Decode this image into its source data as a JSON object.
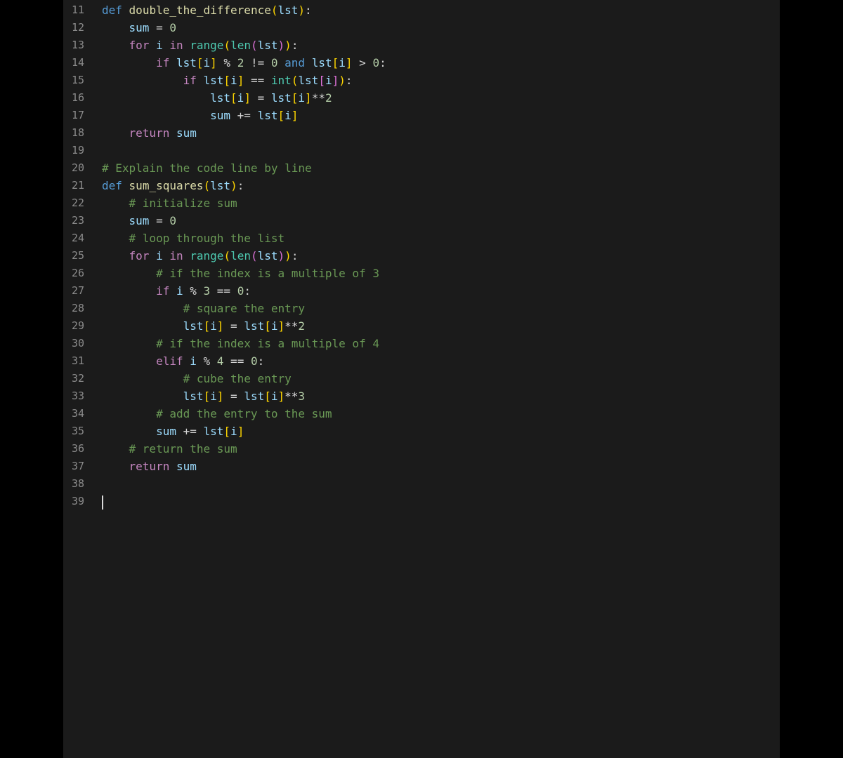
{
  "editor": {
    "background": "#1b1b1b",
    "page_background": "#000000",
    "line_number_color": "#8b8b8b",
    "cursor_color": "#d9d9d9",
    "cursor_line": "39",
    "first_line_number": "11",
    "last_line_number": "39"
  },
  "colors": {
    "pl": "#d4d4d4",
    "kw1": "#C586C0",
    "kw2": "#569CD6",
    "fn": "#DCDCAA",
    "bi": "#4EC9B0",
    "vr": "#9CDCFE",
    "nm": "#B5CEA8",
    "op": "#d4d4d4",
    "cm": "#6A9955",
    "b1": "#FFD700",
    "b2": "#DA70D6"
  },
  "lines": [
    {
      "num": "11",
      "tokens": [
        [
          "def",
          "kw2"
        ],
        [
          " ",
          "pl"
        ],
        [
          "double_the_difference",
          "fn"
        ],
        [
          "(",
          "b1"
        ],
        [
          "lst",
          "vr"
        ],
        [
          ")",
          "b1"
        ],
        [
          ":",
          "op"
        ]
      ]
    },
    {
      "num": "12",
      "tokens": [
        [
          "    ",
          "pl"
        ],
        [
          "sum",
          "vr"
        ],
        [
          " = ",
          "op"
        ],
        [
          "0",
          "nm"
        ]
      ]
    },
    {
      "num": "13",
      "tokens": [
        [
          "    ",
          "pl"
        ],
        [
          "for",
          "kw1"
        ],
        [
          " ",
          "pl"
        ],
        [
          "i",
          "vr"
        ],
        [
          " ",
          "pl"
        ],
        [
          "in",
          "kw1"
        ],
        [
          " ",
          "pl"
        ],
        [
          "range",
          "bi"
        ],
        [
          "(",
          "b1"
        ],
        [
          "len",
          "bi"
        ],
        [
          "(",
          "b2"
        ],
        [
          "lst",
          "vr"
        ],
        [
          ")",
          "b2"
        ],
        [
          ")",
          "b1"
        ],
        [
          ":",
          "op"
        ]
      ]
    },
    {
      "num": "14",
      "tokens": [
        [
          "        ",
          "pl"
        ],
        [
          "if",
          "kw1"
        ],
        [
          " ",
          "pl"
        ],
        [
          "lst",
          "vr"
        ],
        [
          "[",
          "b1"
        ],
        [
          "i",
          "vr"
        ],
        [
          "]",
          "b1"
        ],
        [
          " % ",
          "op"
        ],
        [
          "2",
          "nm"
        ],
        [
          " != ",
          "op"
        ],
        [
          "0",
          "nm"
        ],
        [
          " ",
          "pl"
        ],
        [
          "and",
          "kw2"
        ],
        [
          " ",
          "pl"
        ],
        [
          "lst",
          "vr"
        ],
        [
          "[",
          "b1"
        ],
        [
          "i",
          "vr"
        ],
        [
          "]",
          "b1"
        ],
        [
          " > ",
          "op"
        ],
        [
          "0",
          "nm"
        ],
        [
          ":",
          "op"
        ]
      ]
    },
    {
      "num": "15",
      "tokens": [
        [
          "            ",
          "pl"
        ],
        [
          "if",
          "kw1"
        ],
        [
          " ",
          "pl"
        ],
        [
          "lst",
          "vr"
        ],
        [
          "[",
          "b1"
        ],
        [
          "i",
          "vr"
        ],
        [
          "]",
          "b1"
        ],
        [
          " == ",
          "op"
        ],
        [
          "int",
          "bi"
        ],
        [
          "(",
          "b1"
        ],
        [
          "lst",
          "vr"
        ],
        [
          "[",
          "b2"
        ],
        [
          "i",
          "vr"
        ],
        [
          "]",
          "b2"
        ],
        [
          ")",
          "b1"
        ],
        [
          ":",
          "op"
        ]
      ]
    },
    {
      "num": "16",
      "tokens": [
        [
          "                ",
          "pl"
        ],
        [
          "lst",
          "vr"
        ],
        [
          "[",
          "b1"
        ],
        [
          "i",
          "vr"
        ],
        [
          "]",
          "b1"
        ],
        [
          " = ",
          "op"
        ],
        [
          "lst",
          "vr"
        ],
        [
          "[",
          "b1"
        ],
        [
          "i",
          "vr"
        ],
        [
          "]",
          "b1"
        ],
        [
          "**",
          "op"
        ],
        [
          "2",
          "nm"
        ]
      ]
    },
    {
      "num": "17",
      "tokens": [
        [
          "                ",
          "pl"
        ],
        [
          "sum",
          "vr"
        ],
        [
          " += ",
          "op"
        ],
        [
          "lst",
          "vr"
        ],
        [
          "[",
          "b1"
        ],
        [
          "i",
          "vr"
        ],
        [
          "]",
          "b1"
        ]
      ]
    },
    {
      "num": "18",
      "tokens": [
        [
          "    ",
          "pl"
        ],
        [
          "return",
          "kw1"
        ],
        [
          " ",
          "pl"
        ],
        [
          "sum",
          "vr"
        ]
      ]
    },
    {
      "num": "19",
      "tokens": []
    },
    {
      "num": "20",
      "tokens": [
        [
          "# Explain the code line by line",
          "cm"
        ]
      ]
    },
    {
      "num": "21",
      "tokens": [
        [
          "def",
          "kw2"
        ],
        [
          " ",
          "pl"
        ],
        [
          "sum_squares",
          "fn"
        ],
        [
          "(",
          "b1"
        ],
        [
          "lst",
          "vr"
        ],
        [
          ")",
          "b1"
        ],
        [
          ":",
          "op"
        ]
      ]
    },
    {
      "num": "22",
      "tokens": [
        [
          "    ",
          "pl"
        ],
        [
          "# initialize sum",
          "cm"
        ]
      ]
    },
    {
      "num": "23",
      "tokens": [
        [
          "    ",
          "pl"
        ],
        [
          "sum",
          "vr"
        ],
        [
          " = ",
          "op"
        ],
        [
          "0",
          "nm"
        ]
      ]
    },
    {
      "num": "24",
      "tokens": [
        [
          "    ",
          "pl"
        ],
        [
          "# loop through the list",
          "cm"
        ]
      ]
    },
    {
      "num": "25",
      "tokens": [
        [
          "    ",
          "pl"
        ],
        [
          "for",
          "kw1"
        ],
        [
          " ",
          "pl"
        ],
        [
          "i",
          "vr"
        ],
        [
          " ",
          "pl"
        ],
        [
          "in",
          "kw1"
        ],
        [
          " ",
          "pl"
        ],
        [
          "range",
          "bi"
        ],
        [
          "(",
          "b1"
        ],
        [
          "len",
          "bi"
        ],
        [
          "(",
          "b2"
        ],
        [
          "lst",
          "vr"
        ],
        [
          ")",
          "b2"
        ],
        [
          ")",
          "b1"
        ],
        [
          ":",
          "op"
        ]
      ]
    },
    {
      "num": "26",
      "tokens": [
        [
          "        ",
          "pl"
        ],
        [
          "# if the index is a multiple of 3",
          "cm"
        ]
      ]
    },
    {
      "num": "27",
      "tokens": [
        [
          "        ",
          "pl"
        ],
        [
          "if",
          "kw1"
        ],
        [
          " ",
          "pl"
        ],
        [
          "i",
          "vr"
        ],
        [
          " % ",
          "op"
        ],
        [
          "3",
          "nm"
        ],
        [
          " == ",
          "op"
        ],
        [
          "0",
          "nm"
        ],
        [
          ":",
          "op"
        ]
      ]
    },
    {
      "num": "28",
      "tokens": [
        [
          "            ",
          "pl"
        ],
        [
          "# square the entry",
          "cm"
        ]
      ]
    },
    {
      "num": "29",
      "tokens": [
        [
          "            ",
          "pl"
        ],
        [
          "lst",
          "vr"
        ],
        [
          "[",
          "b1"
        ],
        [
          "i",
          "vr"
        ],
        [
          "]",
          "b1"
        ],
        [
          " = ",
          "op"
        ],
        [
          "lst",
          "vr"
        ],
        [
          "[",
          "b1"
        ],
        [
          "i",
          "vr"
        ],
        [
          "]",
          "b1"
        ],
        [
          "**",
          "op"
        ],
        [
          "2",
          "nm"
        ]
      ]
    },
    {
      "num": "30",
      "tokens": [
        [
          "        ",
          "pl"
        ],
        [
          "# if the index is a multiple of 4",
          "cm"
        ]
      ]
    },
    {
      "num": "31",
      "tokens": [
        [
          "        ",
          "pl"
        ],
        [
          "elif",
          "kw1"
        ],
        [
          " ",
          "pl"
        ],
        [
          "i",
          "vr"
        ],
        [
          " % ",
          "op"
        ],
        [
          "4",
          "nm"
        ],
        [
          " == ",
          "op"
        ],
        [
          "0",
          "nm"
        ],
        [
          ":",
          "op"
        ]
      ]
    },
    {
      "num": "32",
      "tokens": [
        [
          "            ",
          "pl"
        ],
        [
          "# cube the entry",
          "cm"
        ]
      ]
    },
    {
      "num": "33",
      "tokens": [
        [
          "            ",
          "pl"
        ],
        [
          "lst",
          "vr"
        ],
        [
          "[",
          "b1"
        ],
        [
          "i",
          "vr"
        ],
        [
          "]",
          "b1"
        ],
        [
          " = ",
          "op"
        ],
        [
          "lst",
          "vr"
        ],
        [
          "[",
          "b1"
        ],
        [
          "i",
          "vr"
        ],
        [
          "]",
          "b1"
        ],
        [
          "**",
          "op"
        ],
        [
          "3",
          "nm"
        ]
      ]
    },
    {
      "num": "34",
      "tokens": [
        [
          "        ",
          "pl"
        ],
        [
          "# add the entry to the sum",
          "cm"
        ]
      ]
    },
    {
      "num": "35",
      "tokens": [
        [
          "        ",
          "pl"
        ],
        [
          "sum",
          "vr"
        ],
        [
          " += ",
          "op"
        ],
        [
          "lst",
          "vr"
        ],
        [
          "[",
          "b1"
        ],
        [
          "i",
          "vr"
        ],
        [
          "]",
          "b1"
        ]
      ]
    },
    {
      "num": "36",
      "tokens": [
        [
          "    ",
          "pl"
        ],
        [
          "# return the sum",
          "cm"
        ]
      ]
    },
    {
      "num": "37",
      "tokens": [
        [
          "    ",
          "pl"
        ],
        [
          "return",
          "kw1"
        ],
        [
          " ",
          "pl"
        ],
        [
          "sum",
          "vr"
        ]
      ]
    },
    {
      "num": "38",
      "tokens": []
    },
    {
      "num": "39",
      "tokens": [],
      "cursor": true
    }
  ]
}
